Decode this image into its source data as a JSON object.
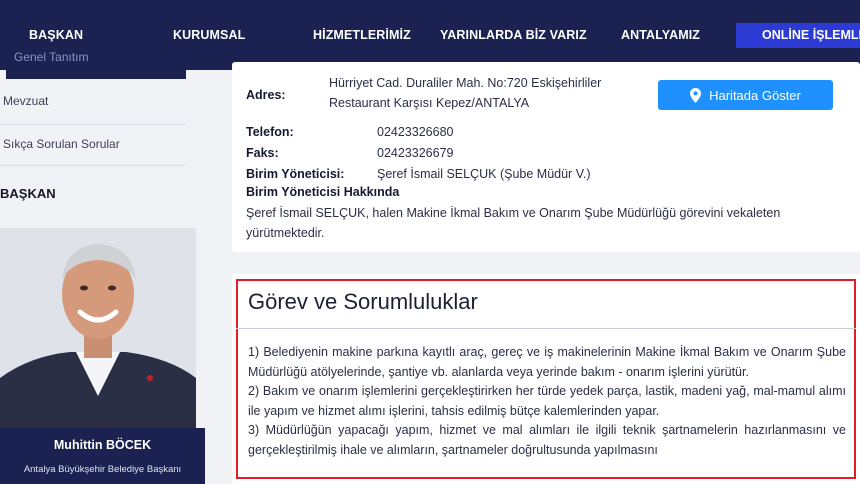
{
  "nav": {
    "items": [
      "BAŞKAN",
      "KURUMSAL",
      "HİZMETLERİMİZ",
      "YARINLARDA BİZ VARIZ",
      "ANTALYAMIZ"
    ],
    "online": "ONLİNE İŞLEMLER"
  },
  "sidebar": {
    "prev_item": "Genel Tanıtım",
    "links": [
      "Mevzuat",
      "Sıkça Sorulan Sorular"
    ],
    "heading": "BAŞKAN",
    "person_name": "Muhittin BÖCEK",
    "person_title": "Antalya Büyükşehir Belediye Başkanı"
  },
  "info": {
    "address_label": "Adres:",
    "address_line1": "Hürriyet Cad. Duraliler Mah. No:720 Eskişehirliler",
    "address_line2": "Restaurant Karşısı Kepez/ANTALYA",
    "map_button": "Haritada Göster",
    "phone_label": "Telefon:",
    "phone": "02423326680",
    "fax_label": "Faks:",
    "fax": "02423326679",
    "manager_label": "Birim Yöneticisi:",
    "manager": "Şeref İsmail SELÇUK (Şube Müdür V.)",
    "about_label": "Birim Yöneticisi Hakkında",
    "about_text": "Şeref İsmail SELÇUK, halen Makine İkmal Bakım ve Onarım Şube Müdürlüğü görevini vekaleten yürütmektedir."
  },
  "duties": {
    "title": "Görev ve Sorumluluklar",
    "items": [
      "1) Belediyenin makine parkına kayıtlı araç, gereç ve iş makinelerinin Makine İkmal Bakım ve Onarım Şube Müdürlüğü atölyelerinde, şantiye vb. alanlarda veya yerinde bakım - onarım işlerini yürütür.",
      "2) Bakım ve onarım işlemlerini gerçekleştirirken her türde yedek parça, lastik, madeni yağ, mal-mamul alımı ile yapım ve hizmet alımı işlerini, tahsis edilmiş bütçe kalemlerinden yapar.",
      "3) Müdürlüğün yapacağı yapım, hizmet ve mal alımları ile ilgili teknik şartnamelerin hazırlanmasını ve gerçekleştirilmiş ihale ve alımların, şartnameler doğrultusunda yapılmasını"
    ]
  },
  "colors": {
    "nav_bg": "#1b2150",
    "online_bg": "#2b3bd4",
    "map_button_bg": "#1e90ff",
    "highlight_border": "#e11d2a"
  }
}
